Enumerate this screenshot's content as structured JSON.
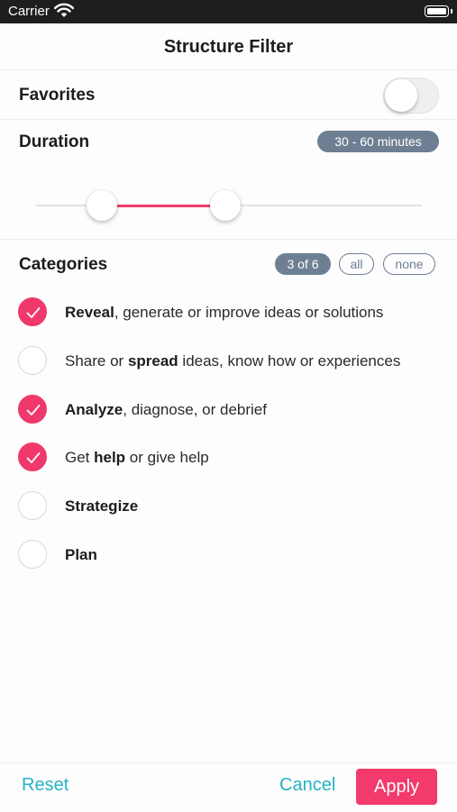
{
  "status_bar": {
    "carrier": "Carrier",
    "wifi_icon": "wifi-icon",
    "battery_icon": "battery-icon"
  },
  "title": "Structure Filter",
  "favorites": {
    "label": "Favorites",
    "enabled": false
  },
  "duration": {
    "label": "Duration",
    "badge": "30 - 60 minutes",
    "range_minutes": [
      30,
      60
    ]
  },
  "categories": {
    "label": "Categories",
    "count_badge": "3 of 6",
    "all_label": "all",
    "none_label": "none",
    "items": [
      {
        "bold": "Reveal",
        "before": "",
        "after": ", generate or improve ideas or solutions",
        "checked": true
      },
      {
        "bold": "spread",
        "before": "Share or ",
        "after": " ideas, know how or experiences",
        "checked": false
      },
      {
        "bold": "Analyze",
        "before": "",
        "after": ", diagnose, or debrief",
        "checked": true
      },
      {
        "bold": "help",
        "before": "Get ",
        "after": " or give help",
        "checked": true
      },
      {
        "bold": "Strategize",
        "before": "",
        "after": "",
        "checked": false
      },
      {
        "bold": "Plan",
        "before": "",
        "after": "",
        "checked": false
      }
    ]
  },
  "footer": {
    "reset_label": "Reset",
    "cancel_label": "Cancel",
    "apply_label": "Apply"
  },
  "colors": {
    "accent": "#f0386d",
    "link": "#27b2c4",
    "badge": "#6f7f93"
  }
}
